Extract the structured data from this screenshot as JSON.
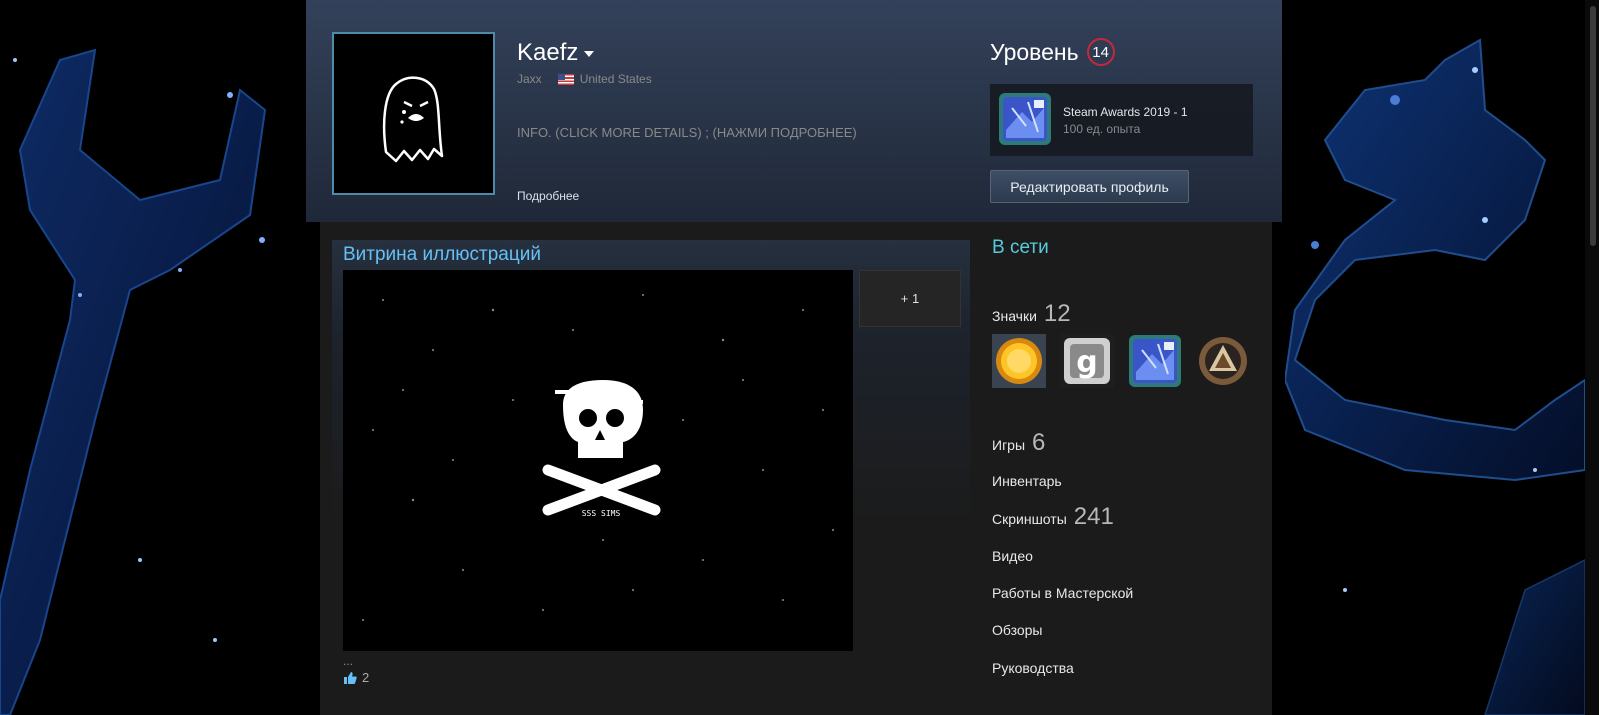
{
  "profile": {
    "persona_name": "Kaefz",
    "real_name": "Jaxx",
    "country": "United States",
    "summary": "INFO. (CLICK MORE DETAILS) ; (НАЖМИ ПОДРОБНЕЕ)",
    "more_link": "Подробнее"
  },
  "level": {
    "label": "Уровень",
    "value": "14"
  },
  "favorite_badge": {
    "title": "Steam Awards 2019 - 1",
    "xp": "100 ед. опыта"
  },
  "edit_button": "Редактировать профиль",
  "showcase": {
    "title": "Витрина иллюстраций",
    "more_count": "+ 1",
    "ellipsis": "...",
    "likes": "2",
    "image_text": "SSS SIMS"
  },
  "sidebar": {
    "status": "В сети",
    "badges_label": "Значки",
    "badges_count": "12",
    "games_label": "Игры",
    "games_count": "6",
    "inventory_label": "Инвентарь",
    "screenshots_label": "Скриншоты",
    "screenshots_count": "241",
    "videos_label": "Видео",
    "workshop_label": "Работы в Мастерской",
    "reviews_label": "Обзоры",
    "guides_label": "Руководства",
    "badge_icons": [
      "gold-coin-badge-icon",
      "g-letter-badge-icon",
      "steam-awards-badge-icon",
      "triangle-emblem-badge-icon"
    ]
  },
  "colors": {
    "accent_blue": "#66c0f4",
    "online_cyan": "#57cbde",
    "level_red": "#c5283d"
  }
}
